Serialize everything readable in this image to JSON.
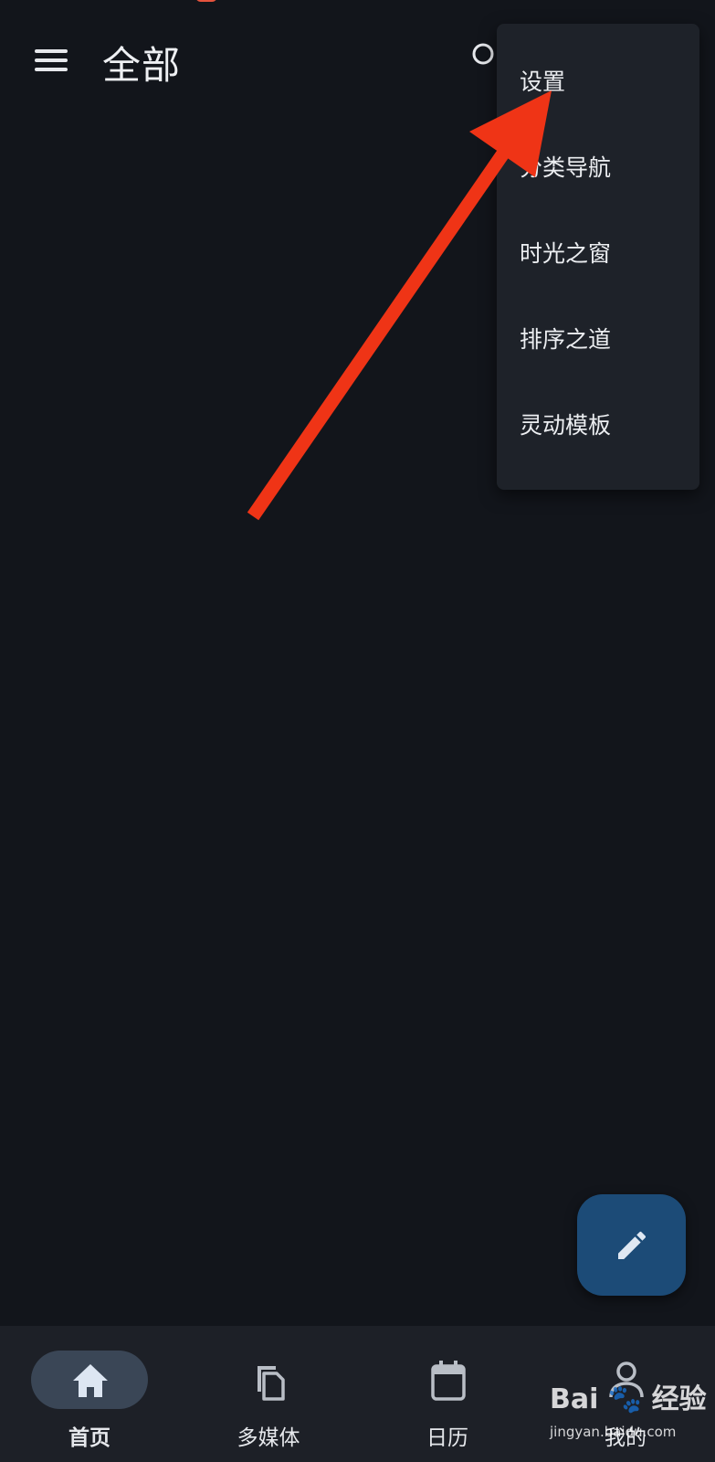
{
  "app_bar": {
    "title": "全部",
    "menu_icon": "hamburger-menu-icon",
    "search_icon": "search-icon"
  },
  "popup_menu": {
    "items": [
      {
        "label": "设置"
      },
      {
        "label": "分类导航"
      },
      {
        "label": "时光之窗"
      },
      {
        "label": "排序之道"
      },
      {
        "label": "灵动模板"
      }
    ]
  },
  "fab": {
    "icon": "pencil-icon",
    "color": "#1c4b77"
  },
  "bottom_nav": {
    "items": [
      {
        "label": "首页",
        "icon": "home-icon",
        "active": true
      },
      {
        "label": "多媒体",
        "icon": "copy-files-icon",
        "active": false
      },
      {
        "label": "日历",
        "icon": "calendar-icon",
        "active": false
      },
      {
        "label": "我的",
        "icon": "person-icon",
        "active": false
      }
    ]
  },
  "watermark": {
    "brand": "Bai",
    "brand_suffix": "经验",
    "url": "jingyan.baidu.com"
  },
  "colors": {
    "background": "#12151b",
    "surface": "#1e2229",
    "accent_arrow": "#ef3416",
    "nav_active_pill": "#3a4656"
  }
}
